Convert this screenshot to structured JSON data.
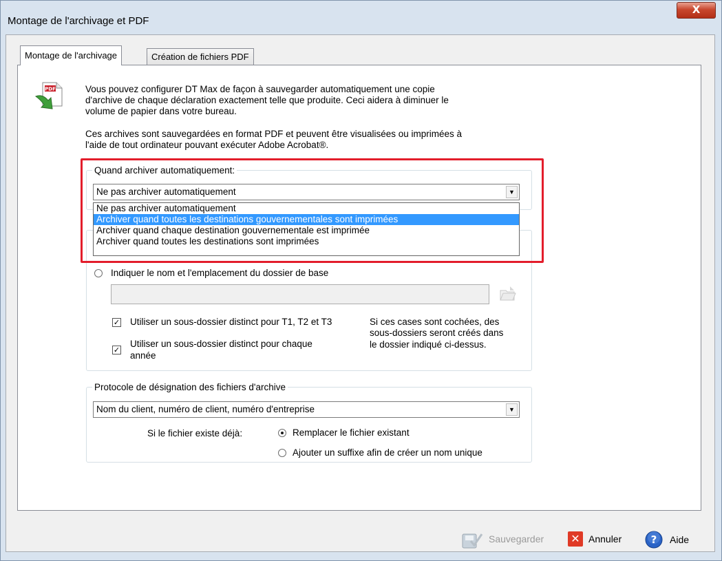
{
  "window": {
    "title": "Montage de l'archivage et PDF",
    "close_glyph": "X"
  },
  "tabs": [
    {
      "label": "Montage de l'archivage",
      "active": true
    },
    {
      "label": "Création de fichiers PDF",
      "active": false
    }
  ],
  "intro": {
    "line1": "Vous pouvez configurer DT Max de façon à sauvegarder automatiquement une copie",
    "line2": "d'archive de chaque déclaration exactement telle que produite. Ceci aidera à diminuer le",
    "line3": "volume de papier dans votre bureau.",
    "line4": "Ces archives sont sauvegardées en format PDF et peuvent être visualisées ou imprimées à",
    "line5": "l'aide de tout ordinateur pouvant exécuter Adobe Acrobat®.",
    "icon_text": "PDF"
  },
  "when_archive": {
    "legend": "Quand archiver automatiquement:",
    "selected": "Ne pas archiver automatiquement",
    "options": [
      "Ne pas archiver automatiquement",
      "Archiver quand toutes les destinations gouvernementales sont imprimées",
      "Archiver quand chaque destination gouvernementale est imprimée",
      "Archiver quand toutes les destinations sont imprimées"
    ],
    "highlighted_index": 1
  },
  "location": {
    "radio_label": "Indiquer le nom et l'emplacement du dossier de base",
    "folder_value": "",
    "sub_t1": "Utiliser un sous-dossier distinct pour T1, T2 et T3",
    "sub_year_1": "Utiliser un sous-dossier distinct pour chaque",
    "sub_year_2": "année",
    "note1": "Si ces cases sont cochées, des",
    "note2": "sous-dossiers seront créés dans",
    "note3": "le dossier indiqué ci-dessus."
  },
  "naming": {
    "legend": "Protocole de désignation des fichiers d'archive",
    "selected": "Nom du client, numéro de client, numéro d'entreprise",
    "exists_label": "Si le fichier existe déjà:",
    "replace_label": "Remplacer le fichier existant",
    "suffix_label": "Ajouter un suffixe afin de créer un nom unique",
    "replace_checked": true
  },
  "footer": {
    "save": "Sauvegarder",
    "cancel": "Annuler",
    "help": "Aide"
  },
  "colors": {
    "highlight_border": "#e31d2b",
    "selection": "#3399ff"
  }
}
